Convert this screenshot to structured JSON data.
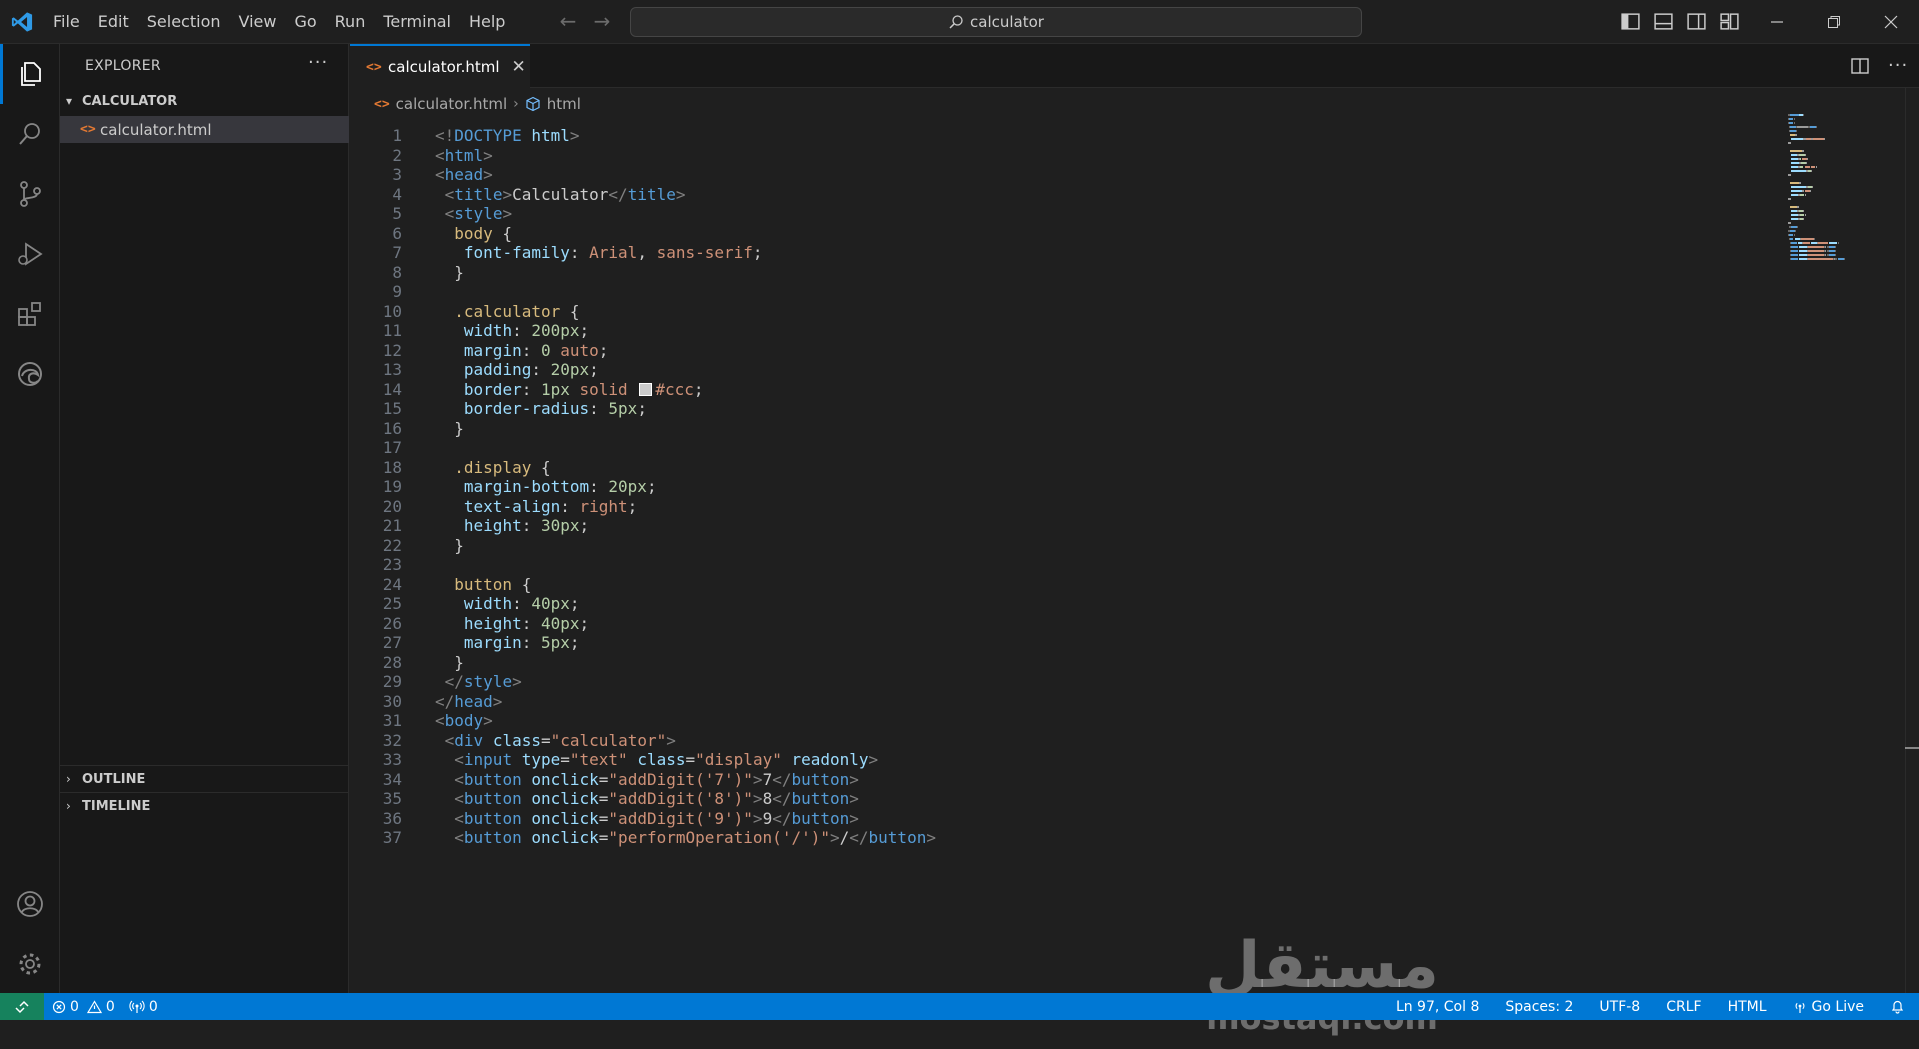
{
  "menu": [
    "File",
    "Edit",
    "Selection",
    "View",
    "Go",
    "Run",
    "Terminal",
    "Help"
  ],
  "search": {
    "text": "calculator"
  },
  "sidebar": {
    "title": "EXPLORER",
    "more": "···",
    "folder": "CALCULATOR",
    "file": "calculator.html",
    "outline": "OUTLINE",
    "timeline": "TIMELINE"
  },
  "tab": {
    "label": "calculator.html",
    "close": "✕",
    "icon": "<>"
  },
  "breadcrumb": {
    "file": "calculator.html",
    "symbol": "html"
  },
  "code": [
    [
      [
        "punct",
        "<!"
      ],
      [
        "tag",
        "DOCTYPE "
      ],
      [
        "attr",
        "html"
      ],
      [
        "punct",
        ">"
      ]
    ],
    [
      [
        "punct",
        "<"
      ],
      [
        "tag",
        "html"
      ],
      [
        "punct",
        ">"
      ]
    ],
    [
      [
        "punct",
        "<"
      ],
      [
        "tag",
        "head"
      ],
      [
        "punct",
        ">"
      ]
    ],
    [
      [
        "text",
        " "
      ],
      [
        "punct",
        "<"
      ],
      [
        "tag",
        "title"
      ],
      [
        "punct",
        ">"
      ],
      [
        "text",
        "Calculator"
      ],
      [
        "punct",
        "</"
      ],
      [
        "tag",
        "title"
      ],
      [
        "punct",
        ">"
      ]
    ],
    [
      [
        "text",
        " "
      ],
      [
        "punct",
        "<"
      ],
      [
        "tag",
        "style"
      ],
      [
        "punct",
        ">"
      ]
    ],
    [
      [
        "text",
        "  "
      ],
      [
        "sel",
        "body"
      ],
      [
        "text",
        " {"
      ]
    ],
    [
      [
        "text",
        "   "
      ],
      [
        "attr",
        "font-family"
      ],
      [
        "text",
        ": "
      ],
      [
        "str",
        "Arial"
      ],
      [
        "text",
        ", "
      ],
      [
        "str",
        "sans-serif"
      ],
      [
        "text",
        ";"
      ]
    ],
    [
      [
        "text",
        "  }"
      ]
    ],
    [],
    [
      [
        "text",
        "  "
      ],
      [
        "sel",
        ".calculator"
      ],
      [
        "text",
        " {"
      ]
    ],
    [
      [
        "text",
        "   "
      ],
      [
        "attr",
        "width"
      ],
      [
        "text",
        ": "
      ],
      [
        "num",
        "200px"
      ],
      [
        "text",
        ";"
      ]
    ],
    [
      [
        "text",
        "   "
      ],
      [
        "attr",
        "margin"
      ],
      [
        "text",
        ": "
      ],
      [
        "num",
        "0"
      ],
      [
        "text",
        " "
      ],
      [
        "str",
        "auto"
      ],
      [
        "text",
        ";"
      ]
    ],
    [
      [
        "text",
        "   "
      ],
      [
        "attr",
        "padding"
      ],
      [
        "text",
        ": "
      ],
      [
        "num",
        "20px"
      ],
      [
        "text",
        ";"
      ]
    ],
    [
      [
        "text",
        "   "
      ],
      [
        "attr",
        "border"
      ],
      [
        "text",
        ": "
      ],
      [
        "num",
        "1px"
      ],
      [
        "text",
        " "
      ],
      [
        "str",
        "solid"
      ],
      [
        "text",
        " "
      ],
      [
        "swatch",
        ""
      ],
      [
        "str",
        "#ccc"
      ],
      [
        "text",
        ";"
      ]
    ],
    [
      [
        "text",
        "   "
      ],
      [
        "attr",
        "border-radius"
      ],
      [
        "text",
        ": "
      ],
      [
        "num",
        "5px"
      ],
      [
        "text",
        ";"
      ]
    ],
    [
      [
        "text",
        "  }"
      ]
    ],
    [],
    [
      [
        "text",
        "  "
      ],
      [
        "sel",
        ".display"
      ],
      [
        "text",
        " {"
      ]
    ],
    [
      [
        "text",
        "   "
      ],
      [
        "attr",
        "margin-bottom"
      ],
      [
        "text",
        ": "
      ],
      [
        "num",
        "20px"
      ],
      [
        "text",
        ";"
      ]
    ],
    [
      [
        "text",
        "   "
      ],
      [
        "attr",
        "text-align"
      ],
      [
        "text",
        ": "
      ],
      [
        "str",
        "right"
      ],
      [
        "text",
        ";"
      ]
    ],
    [
      [
        "text",
        "   "
      ],
      [
        "attr",
        "height"
      ],
      [
        "text",
        ": "
      ],
      [
        "num",
        "30px"
      ],
      [
        "text",
        ";"
      ]
    ],
    [
      [
        "text",
        "  }"
      ]
    ],
    [],
    [
      [
        "text",
        "  "
      ],
      [
        "sel",
        "button"
      ],
      [
        "text",
        " {"
      ]
    ],
    [
      [
        "text",
        "   "
      ],
      [
        "attr",
        "width"
      ],
      [
        "text",
        ": "
      ],
      [
        "num",
        "40px"
      ],
      [
        "text",
        ";"
      ]
    ],
    [
      [
        "text",
        "   "
      ],
      [
        "attr",
        "height"
      ],
      [
        "text",
        ": "
      ],
      [
        "num",
        "40px"
      ],
      [
        "text",
        ";"
      ]
    ],
    [
      [
        "text",
        "   "
      ],
      [
        "attr",
        "margin"
      ],
      [
        "text",
        ": "
      ],
      [
        "num",
        "5px"
      ],
      [
        "text",
        ";"
      ]
    ],
    [
      [
        "text",
        "  }"
      ]
    ],
    [
      [
        "text",
        " "
      ],
      [
        "punct",
        "</"
      ],
      [
        "tag",
        "style"
      ],
      [
        "punct",
        ">"
      ]
    ],
    [
      [
        "punct",
        "</"
      ],
      [
        "tag",
        "head"
      ],
      [
        "punct",
        ">"
      ]
    ],
    [
      [
        "punct",
        "<"
      ],
      [
        "tag",
        "body"
      ],
      [
        "punct",
        ">"
      ]
    ],
    [
      [
        "text",
        " "
      ],
      [
        "punct",
        "<"
      ],
      [
        "tag",
        "div"
      ],
      [
        "text",
        " "
      ],
      [
        "attr",
        "class"
      ],
      [
        "text",
        "="
      ],
      [
        "str",
        "\"calculator\""
      ],
      [
        "punct",
        ">"
      ]
    ],
    [
      [
        "text",
        "  "
      ],
      [
        "punct",
        "<"
      ],
      [
        "tag",
        "input"
      ],
      [
        "text",
        " "
      ],
      [
        "attr",
        "type"
      ],
      [
        "text",
        "="
      ],
      [
        "str",
        "\"text\""
      ],
      [
        "text",
        " "
      ],
      [
        "attr",
        "class"
      ],
      [
        "text",
        "="
      ],
      [
        "str",
        "\"display\""
      ],
      [
        "text",
        " "
      ],
      [
        "attr",
        "readonly"
      ],
      [
        "punct",
        ">"
      ]
    ],
    [
      [
        "text",
        "  "
      ],
      [
        "punct",
        "<"
      ],
      [
        "tag",
        "button"
      ],
      [
        "text",
        " "
      ],
      [
        "attr",
        "onclick"
      ],
      [
        "text",
        "="
      ],
      [
        "str",
        "\"addDigit('7')\""
      ],
      [
        "punct",
        ">"
      ],
      [
        "text",
        "7"
      ],
      [
        "punct",
        "</"
      ],
      [
        "tag",
        "button"
      ],
      [
        "punct",
        ">"
      ]
    ],
    [
      [
        "text",
        "  "
      ],
      [
        "punct",
        "<"
      ],
      [
        "tag",
        "button"
      ],
      [
        "text",
        " "
      ],
      [
        "attr",
        "onclick"
      ],
      [
        "text",
        "="
      ],
      [
        "str",
        "\"addDigit('8')\""
      ],
      [
        "punct",
        ">"
      ],
      [
        "text",
        "8"
      ],
      [
        "punct",
        "</"
      ],
      [
        "tag",
        "button"
      ],
      [
        "punct",
        ">"
      ]
    ],
    [
      [
        "text",
        "  "
      ],
      [
        "punct",
        "<"
      ],
      [
        "tag",
        "button"
      ],
      [
        "text",
        " "
      ],
      [
        "attr",
        "onclick"
      ],
      [
        "text",
        "="
      ],
      [
        "str",
        "\"addDigit('9')\""
      ],
      [
        "punct",
        ">"
      ],
      [
        "text",
        "9"
      ],
      [
        "punct",
        "</"
      ],
      [
        "tag",
        "button"
      ],
      [
        "punct",
        ">"
      ]
    ],
    [
      [
        "text",
        "  "
      ],
      [
        "punct",
        "<"
      ],
      [
        "tag",
        "button"
      ],
      [
        "text",
        " "
      ],
      [
        "attr",
        "onclick"
      ],
      [
        "text",
        "="
      ],
      [
        "str",
        "\"performOperation('/')\""
      ],
      [
        "punct",
        ">"
      ],
      [
        "text",
        "/"
      ],
      [
        "punct",
        "</"
      ],
      [
        "tag",
        "button"
      ],
      [
        "punct",
        ">"
      ]
    ]
  ],
  "watermark": {
    "arabic": "مستقل",
    "latin": "mostaql.com"
  },
  "status": {
    "errors": "0",
    "warnings": "0",
    "ports": "0",
    "position": "Ln 97, Col 8",
    "spaces": "Spaces: 2",
    "encoding": "UTF-8",
    "eol": "CRLF",
    "language": "HTML",
    "golive": "Go Live"
  },
  "colors": {
    "accent": "#0078d4",
    "remote": "#16825d",
    "htmlIcon": "#e37933"
  }
}
